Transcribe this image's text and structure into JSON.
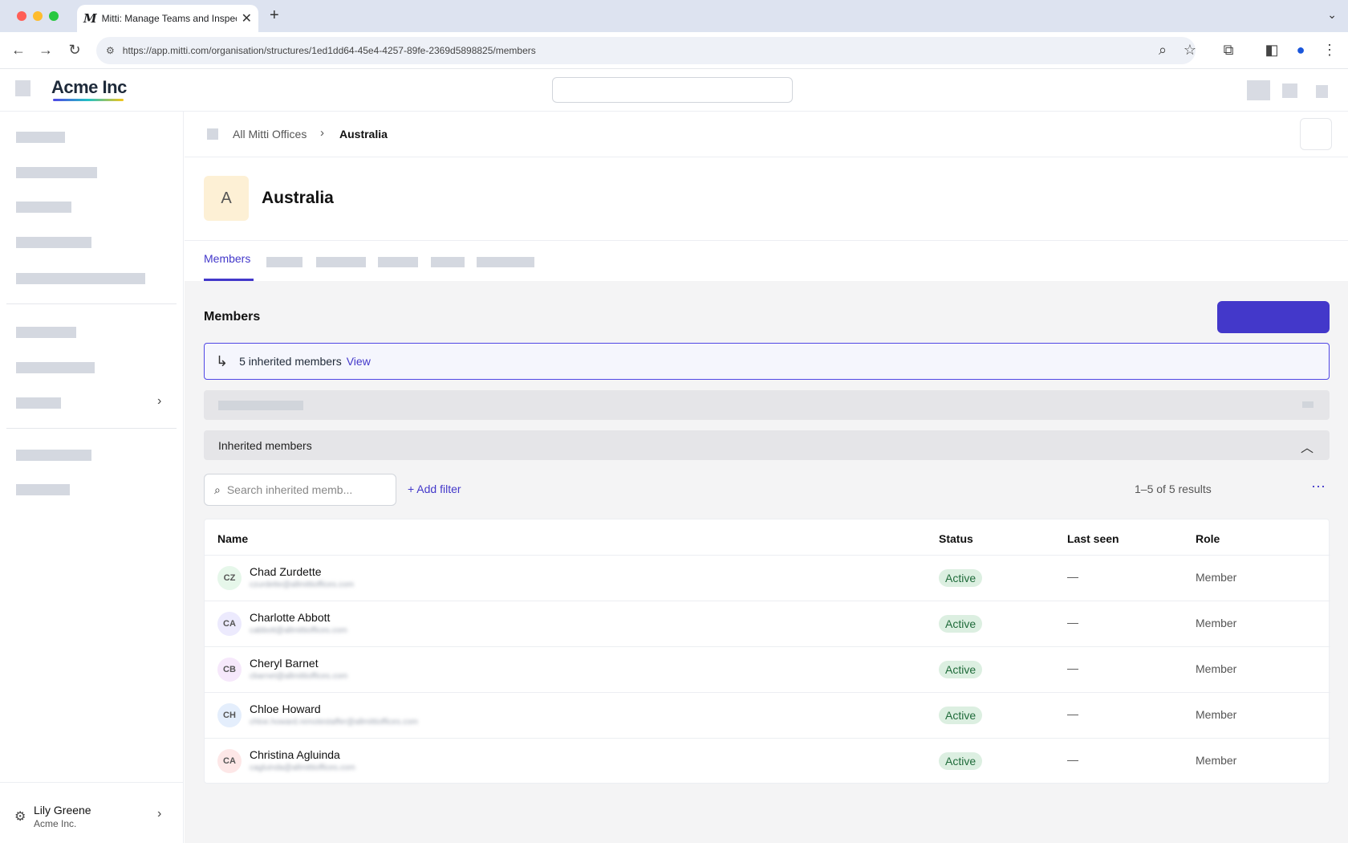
{
  "browser": {
    "tab_title": "Mitti: Manage Teams and Inspect...",
    "favicon": "M",
    "url": "https://app.mitti.com/organisation/structures/1ed1dd64-45e4-4257-89fe-2369d5898825/members"
  },
  "header": {
    "logo": "Acme Inc"
  },
  "sidebar": {
    "user": {
      "name": "Lily Greene",
      "org": "Acme Inc."
    }
  },
  "breadcrumb": {
    "parent": "All Mitti Offices",
    "separator": "›",
    "current": "Australia"
  },
  "page": {
    "avatar_letter": "A",
    "title": "Australia"
  },
  "tabs": {
    "active": "Members"
  },
  "members": {
    "heading": "Members",
    "banner": {
      "text": "5 inherited members",
      "link": "View"
    },
    "section_title": "Inherited members",
    "search_placeholder": "Search inherited memb...",
    "add_filter": "Add filter",
    "results": "1–5 of 5 results",
    "columns": {
      "name": "Name",
      "status": "Status",
      "last_seen": "Last seen",
      "role": "Role"
    },
    "rows": [
      {
        "initials": "CZ",
        "name": "Chad Zurdette",
        "email": "czurdette@allmittioffices.com",
        "status": "Active",
        "last_seen": "—",
        "role": "Member",
        "avatar_color": "#e6f7ea"
      },
      {
        "initials": "CA",
        "name": "Charlotte Abbott",
        "email": "cabbott@allmittioffices.com",
        "status": "Active",
        "last_seen": "—",
        "role": "Member",
        "avatar_color": "#eceafd"
      },
      {
        "initials": "CB",
        "name": "Cheryl Barnet",
        "email": "cbarnet@allmittioffices.com",
        "status": "Active",
        "last_seen": "—",
        "role": "Member",
        "avatar_color": "#f6e8fb"
      },
      {
        "initials": "CH",
        "name": "Chloe Howard",
        "email": "chloe.howard.remotestaffer@allmittioffices.com",
        "status": "Active",
        "last_seen": "—",
        "role": "Member",
        "avatar_color": "#e4eefc"
      },
      {
        "initials": "CA",
        "name": "Christina Agluinda",
        "email": "cagluinda@allmittioffices.com",
        "status": "Active",
        "last_seen": "—",
        "role": "Member",
        "avatar_color": "#fde7e7"
      }
    ]
  },
  "colors": {
    "accent": "#4338ca",
    "active_badge_bg": "#dcefe1",
    "active_badge_text": "#1f6b3a"
  }
}
